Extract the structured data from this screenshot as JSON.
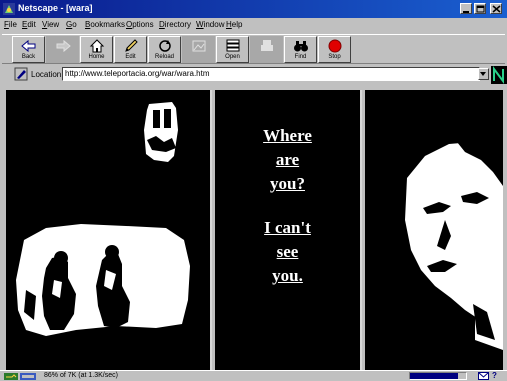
{
  "window": {
    "title": "Netscape - [wara]"
  },
  "menu": {
    "items": [
      {
        "key": "F",
        "rest": "ile"
      },
      {
        "key": "E",
        "rest": "dit"
      },
      {
        "key": "V",
        "rest": "iew"
      },
      {
        "key": "G",
        "rest": "o"
      },
      {
        "key": "B",
        "rest": "ookmarks"
      },
      {
        "key": "O",
        "rest": "ptions"
      },
      {
        "key": "D",
        "rest": "irectory"
      },
      {
        "key": "W",
        "rest": "indow"
      },
      {
        "key": "H",
        "rest": "elp"
      }
    ]
  },
  "toolbar": {
    "back": "Back",
    "forward": "",
    "home": "Home",
    "edit": "Edit",
    "reload": "Reload",
    "images": "",
    "open": "Open",
    "print": "",
    "find": "Find",
    "stop": "Stop"
  },
  "location": {
    "label": "Location:",
    "url": "http://www.teleportacia.org/war/wara.htm"
  },
  "page": {
    "lines": [
      "Where",
      "are",
      "you?",
      "I can't",
      "see",
      "you."
    ]
  },
  "status": {
    "text": "86% of 7K (at 1.3K/sec)",
    "progress": 0.86
  },
  "colors": {
    "title_start": "#0a1a8c",
    "title_end": "#1a5fd0",
    "stop_red": "#e00000",
    "page_bg": "#000000"
  }
}
